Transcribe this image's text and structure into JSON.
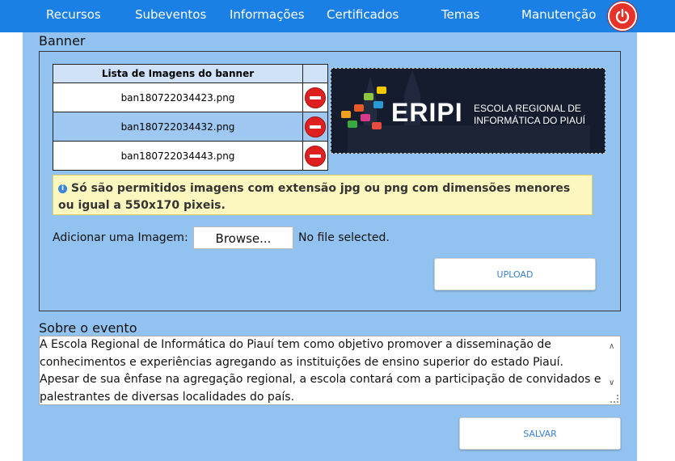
{
  "nav": {
    "items": [
      "Recursos",
      "Subeventos",
      "Informações",
      "Certificados",
      "Temas",
      "Manutenção"
    ]
  },
  "banner": {
    "section_title": "Banner",
    "table_header": "Lista de Imagens do banner",
    "images": [
      "ban180722034423.png",
      "ban180722034432.png",
      "ban180722034443.png"
    ],
    "preview_logo": "ERIPI",
    "preview_subtitle_line1": "ESCOLA REGIONAL DE",
    "preview_subtitle_line2": "INFORMÁTICA DO PIAUÍ",
    "alert_text": "Só são permitidos imagens com extensão jpg ou png com dimensões menores ou igual a 550x170 pixeis.",
    "file_label": "Adicionar uma Imagem:",
    "browse_label": "Browse...",
    "file_status": "No file selected.",
    "upload_label": "UPLOAD"
  },
  "about": {
    "section_title": "Sobre o evento",
    "text": "A Escola Regional de Informática do Piauí tem como objetivo promover a disseminação de conhecimentos e experiências agregando as instituições de ensino superior do estado Piauí. Apesar de sua ênfase na agregação regional, a escola contará com a participação de convidados e palestrantes de diversas localidades do país.",
    "save_label": "SALVAR"
  },
  "colors": {
    "nav_bg": "#1a80e5",
    "panel_bg": "#92c2f0",
    "alert_bg": "#fcf7bf",
    "power_red": "#e63228",
    "button_text": "#3a80c8"
  },
  "icons": [
    "power-icon",
    "delete-icon",
    "info-icon"
  ]
}
